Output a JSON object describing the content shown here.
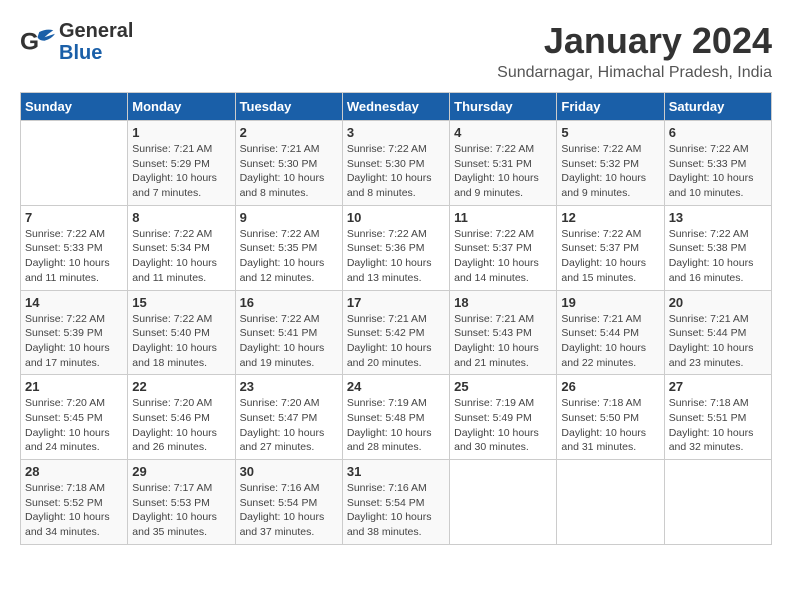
{
  "header": {
    "logo_line1": "General",
    "logo_line2": "Blue",
    "month_title": "January 2024",
    "subtitle": "Sundarnagar, Himachal Pradesh, India"
  },
  "weekdays": [
    "Sunday",
    "Monday",
    "Tuesday",
    "Wednesday",
    "Thursday",
    "Friday",
    "Saturday"
  ],
  "weeks": [
    [
      {
        "day": "",
        "info": ""
      },
      {
        "day": "1",
        "info": "Sunrise: 7:21 AM\nSunset: 5:29 PM\nDaylight: 10 hours\nand 7 minutes."
      },
      {
        "day": "2",
        "info": "Sunrise: 7:21 AM\nSunset: 5:30 PM\nDaylight: 10 hours\nand 8 minutes."
      },
      {
        "day": "3",
        "info": "Sunrise: 7:22 AM\nSunset: 5:30 PM\nDaylight: 10 hours\nand 8 minutes."
      },
      {
        "day": "4",
        "info": "Sunrise: 7:22 AM\nSunset: 5:31 PM\nDaylight: 10 hours\nand 9 minutes."
      },
      {
        "day": "5",
        "info": "Sunrise: 7:22 AM\nSunset: 5:32 PM\nDaylight: 10 hours\nand 9 minutes."
      },
      {
        "day": "6",
        "info": "Sunrise: 7:22 AM\nSunset: 5:33 PM\nDaylight: 10 hours\nand 10 minutes."
      }
    ],
    [
      {
        "day": "7",
        "info": "Sunrise: 7:22 AM\nSunset: 5:33 PM\nDaylight: 10 hours\nand 11 minutes."
      },
      {
        "day": "8",
        "info": "Sunrise: 7:22 AM\nSunset: 5:34 PM\nDaylight: 10 hours\nand 11 minutes."
      },
      {
        "day": "9",
        "info": "Sunrise: 7:22 AM\nSunset: 5:35 PM\nDaylight: 10 hours\nand 12 minutes."
      },
      {
        "day": "10",
        "info": "Sunrise: 7:22 AM\nSunset: 5:36 PM\nDaylight: 10 hours\nand 13 minutes."
      },
      {
        "day": "11",
        "info": "Sunrise: 7:22 AM\nSunset: 5:37 PM\nDaylight: 10 hours\nand 14 minutes."
      },
      {
        "day": "12",
        "info": "Sunrise: 7:22 AM\nSunset: 5:37 PM\nDaylight: 10 hours\nand 15 minutes."
      },
      {
        "day": "13",
        "info": "Sunrise: 7:22 AM\nSunset: 5:38 PM\nDaylight: 10 hours\nand 16 minutes."
      }
    ],
    [
      {
        "day": "14",
        "info": "Sunrise: 7:22 AM\nSunset: 5:39 PM\nDaylight: 10 hours\nand 17 minutes."
      },
      {
        "day": "15",
        "info": "Sunrise: 7:22 AM\nSunset: 5:40 PM\nDaylight: 10 hours\nand 18 minutes."
      },
      {
        "day": "16",
        "info": "Sunrise: 7:22 AM\nSunset: 5:41 PM\nDaylight: 10 hours\nand 19 minutes."
      },
      {
        "day": "17",
        "info": "Sunrise: 7:21 AM\nSunset: 5:42 PM\nDaylight: 10 hours\nand 20 minutes."
      },
      {
        "day": "18",
        "info": "Sunrise: 7:21 AM\nSunset: 5:43 PM\nDaylight: 10 hours\nand 21 minutes."
      },
      {
        "day": "19",
        "info": "Sunrise: 7:21 AM\nSunset: 5:44 PM\nDaylight: 10 hours\nand 22 minutes."
      },
      {
        "day": "20",
        "info": "Sunrise: 7:21 AM\nSunset: 5:44 PM\nDaylight: 10 hours\nand 23 minutes."
      }
    ],
    [
      {
        "day": "21",
        "info": "Sunrise: 7:20 AM\nSunset: 5:45 PM\nDaylight: 10 hours\nand 24 minutes."
      },
      {
        "day": "22",
        "info": "Sunrise: 7:20 AM\nSunset: 5:46 PM\nDaylight: 10 hours\nand 26 minutes."
      },
      {
        "day": "23",
        "info": "Sunrise: 7:20 AM\nSunset: 5:47 PM\nDaylight: 10 hours\nand 27 minutes."
      },
      {
        "day": "24",
        "info": "Sunrise: 7:19 AM\nSunset: 5:48 PM\nDaylight: 10 hours\nand 28 minutes."
      },
      {
        "day": "25",
        "info": "Sunrise: 7:19 AM\nSunset: 5:49 PM\nDaylight: 10 hours\nand 30 minutes."
      },
      {
        "day": "26",
        "info": "Sunrise: 7:18 AM\nSunset: 5:50 PM\nDaylight: 10 hours\nand 31 minutes."
      },
      {
        "day": "27",
        "info": "Sunrise: 7:18 AM\nSunset: 5:51 PM\nDaylight: 10 hours\nand 32 minutes."
      }
    ],
    [
      {
        "day": "28",
        "info": "Sunrise: 7:18 AM\nSunset: 5:52 PM\nDaylight: 10 hours\nand 34 minutes."
      },
      {
        "day": "29",
        "info": "Sunrise: 7:17 AM\nSunset: 5:53 PM\nDaylight: 10 hours\nand 35 minutes."
      },
      {
        "day": "30",
        "info": "Sunrise: 7:16 AM\nSunset: 5:54 PM\nDaylight: 10 hours\nand 37 minutes."
      },
      {
        "day": "31",
        "info": "Sunrise: 7:16 AM\nSunset: 5:54 PM\nDaylight: 10 hours\nand 38 minutes."
      },
      {
        "day": "",
        "info": ""
      },
      {
        "day": "",
        "info": ""
      },
      {
        "day": "",
        "info": ""
      }
    ]
  ]
}
